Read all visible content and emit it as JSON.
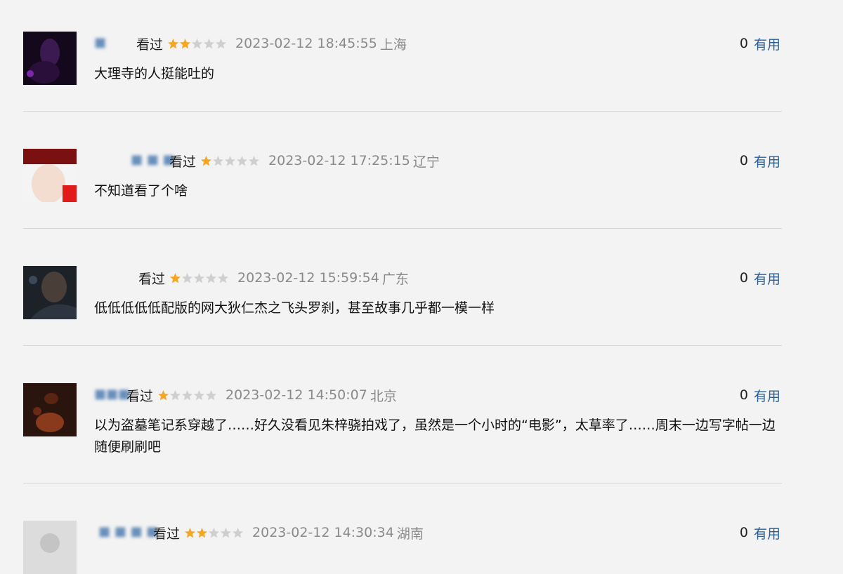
{
  "useful_label": "有用",
  "comments": [
    {
      "username": "■",
      "status": "看过",
      "rating": 2,
      "time": "2023-02-12 18:45:55",
      "location": "上海",
      "votes": "0",
      "text": "大理寺的人挺能吐的"
    },
    {
      "username": "■ ■ ■",
      "status": "看过",
      "rating": 1,
      "time": "2023-02-12 17:25:15",
      "location": "辽宁",
      "votes": "0",
      "text": "不知道看了个啥"
    },
    {
      "username": "",
      "status": "看过",
      "rating": 1,
      "time": "2023-02-12 15:59:54",
      "location": "广东",
      "votes": "0",
      "text": "低低低低低配版的网大狄仁杰之飞头罗刹，甚至故事几乎都一模一样"
    },
    {
      "username": "■■■",
      "status": "看过",
      "rating": 1,
      "time": "2023-02-12 14:50:07",
      "location": "北京",
      "votes": "0",
      "text": "以为盗墓笔记系穿越了……好久没看见朱梓骁拍戏了，虽然是一个小时的“电影”，太草率了……周末一边写字帖一边随便刷刷吧"
    },
    {
      "username": "■ ■ ■ ■",
      "status": "看过",
      "rating": 2,
      "time": "2023-02-12 14:30:34",
      "location": "湖南",
      "votes": "0",
      "text": ""
    }
  ],
  "colors": {
    "star_on": "#f5a623",
    "star_off": "#cfcfcf",
    "link": "#2a5f99"
  }
}
